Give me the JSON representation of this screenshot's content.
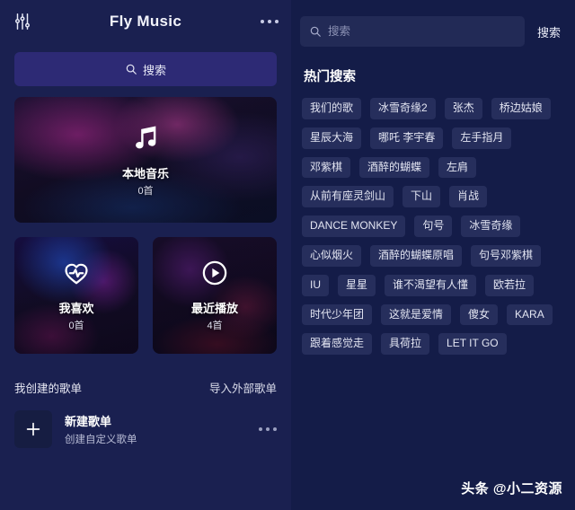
{
  "window": {
    "title": "Fly Music",
    "eq_icon": "equalizer-icon",
    "more_icon": "more-horizontal-icon"
  },
  "left": {
    "search": {
      "label": "搜索",
      "icon": "search-icon"
    },
    "cards": {
      "local": {
        "title": "本地音乐",
        "count": "0首",
        "icon": "music-note-icon"
      },
      "liked": {
        "title": "我喜欢",
        "count": "0首",
        "icon": "heart-pulse-icon"
      },
      "recent": {
        "title": "最近播放",
        "count": "4首",
        "icon": "play-circle-icon"
      }
    },
    "playlist_section": {
      "label": "我创建的歌单",
      "import_label": "导入外部歌单",
      "new_playlist": {
        "title": "新建歌单",
        "subtitle": "创建自定义歌单",
        "plus_icon": "plus-icon",
        "more_icon": "more-horizontal-icon"
      }
    }
  },
  "right": {
    "search": {
      "placeholder": "搜索",
      "value": "",
      "icon": "search-icon",
      "button_label": "搜索"
    },
    "hot_searches": {
      "title": "热门搜索",
      "tags": [
        "我们的歌",
        "冰雪奇缘2",
        "张杰",
        "桥边姑娘",
        "星辰大海",
        "哪吒 李宇春",
        "左手指月",
        "邓紫棋",
        "酒醉的蝴蝶",
        "左肩",
        "从前有座灵剑山",
        "下山",
        "肖战",
        "DANCE MONKEY",
        "句号",
        "冰雪奇缘",
        "心似烟火",
        "酒醉的蝴蝶原唱",
        "句号邓紫棋",
        "IU",
        "星星",
        "谁不渴望有人懂",
        "欧若拉",
        "时代少年团",
        "这就是爱情",
        "傻女",
        "KARA",
        "跟着感觉走",
        "具荷拉",
        "LET IT GO"
      ]
    }
  },
  "watermark": {
    "text": "头条 @小二资源"
  },
  "colors": {
    "left_panel_bg": "#1a2050",
    "right_panel_bg": "#141c48",
    "left_search_bg": "#2d2a75",
    "right_search_bg": "#222a56",
    "tag_bg": "#262e5c",
    "text_primary": "#ffffff",
    "text_muted": "#b9bdd6"
  }
}
